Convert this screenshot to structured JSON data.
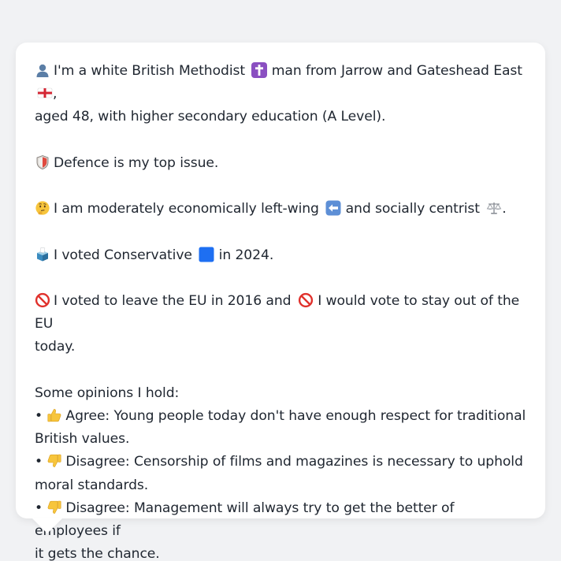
{
  "message": {
    "identity": {
      "icon": "person-silhouette-icon",
      "text_1": "I'm a white British Methodist",
      "religion_icon": "latin-cross-icon",
      "text_2": "man from Jarrow and Gateshead East",
      "flag_icon": "england-flag-icon",
      "text_3": ",",
      "text_4": "aged 48, with higher secondary education (A Level)."
    },
    "top_issue": {
      "icon": "shield-icon",
      "text": "Defence is my top issue."
    },
    "ideology": {
      "icon": "thinking-face-icon",
      "text_1": "I am moderately economically left-wing",
      "left_icon": "left-arrow-icon",
      "text_2": "and socially centrist",
      "scale_icon": "balance-scale-icon",
      "text_3": "."
    },
    "vote_2024": {
      "icon": "ballot-box-icon",
      "text_1": "I voted Conservative",
      "party_icon": "blue-square-icon",
      "text_2": "in 2024."
    },
    "eu": {
      "icon_1": "prohibited-icon",
      "text_1": "I voted to leave the EU in 2016 and",
      "icon_2": "prohibited-icon",
      "text_2": "I would vote to stay out of the EU",
      "text_3": "today."
    },
    "opinions": {
      "heading": "Some opinions I hold:",
      "bullet": "•",
      "items": [
        {
          "icon": "thumbs-up-icon",
          "label": "Agree:",
          "text_1": "Young people today don't have enough respect for traditional",
          "text_2": "British values."
        },
        {
          "icon": "thumbs-down-icon",
          "label": "Disagree:",
          "text_1": "Censorship of films and magazines is necessary to uphold",
          "text_2": "moral standards."
        },
        {
          "icon": "thumbs-down-icon",
          "label": "Disagree:",
          "text_1": "Management will always try to get the better of employees if",
          "text_2": "it gets the chance."
        }
      ]
    }
  },
  "colors": {
    "background": "#f1f2f4",
    "bubble": "#ffffff",
    "text": "#1f2630",
    "party_blue": "#1e6ff2",
    "prohibited_red": "#e0312c"
  }
}
